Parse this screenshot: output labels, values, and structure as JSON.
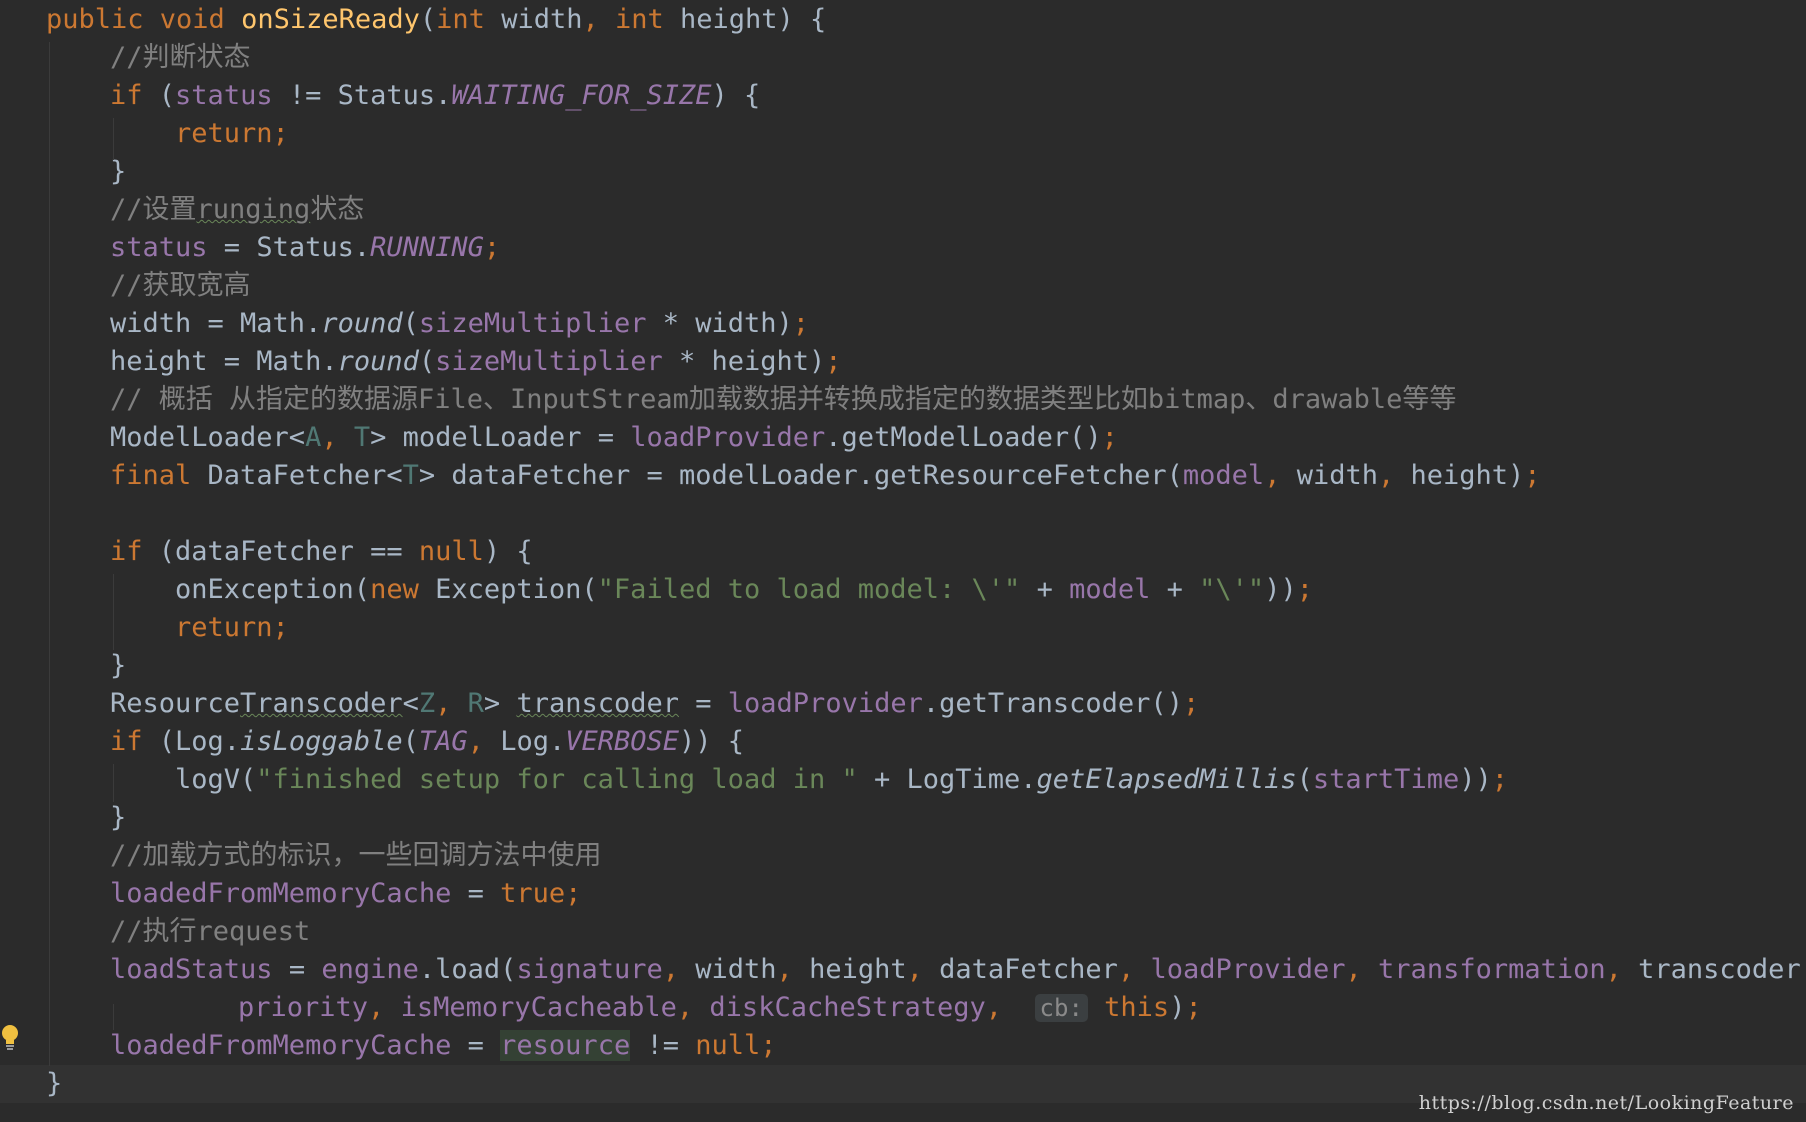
{
  "watermark": "https://blog.csdn.net/LookingFeature",
  "colors": {
    "background": "#2b2b2b",
    "keyword": "#cc7832",
    "method_decl": "#ffc66d",
    "field": "#9876aa",
    "comment": "#808080",
    "string": "#6a8759",
    "plain": "#a9b7c6",
    "type_param": "#507874"
  },
  "icons": {
    "gutter": "lightbulb-icon"
  },
  "current_line": 28,
  "lines": [
    [
      [
        "kw",
        "public void "
      ],
      [
        "fn",
        "onSizeReady"
      ],
      [
        "p",
        "("
      ],
      [
        "kw",
        "int "
      ],
      [
        "p",
        "width"
      ],
      [
        "kw",
        ", "
      ],
      [
        "kw",
        "int "
      ],
      [
        "p",
        "height) {"
      ]
    ],
    [
      [
        "cmt",
        "//判断状态"
      ]
    ],
    [
      [
        "kw",
        "if "
      ],
      [
        "p",
        "("
      ],
      [
        "f",
        "status"
      ],
      [
        "p",
        " != Status."
      ],
      [
        "fi",
        "WAITING_FOR_SIZE"
      ],
      [
        "p",
        ") {"
      ]
    ],
    [
      [
        "kw",
        "return;"
      ]
    ],
    [
      [
        "p",
        "}"
      ]
    ],
    [
      [
        "cmt",
        "//设置"
      ],
      [
        "cmt-typo",
        "runging"
      ],
      [
        "cmt",
        "状态"
      ]
    ],
    [
      [
        "f",
        "status"
      ],
      [
        "p",
        " = Status."
      ],
      [
        "fi",
        "RUNNING"
      ],
      [
        "kw",
        ";"
      ]
    ],
    [
      [
        "cmt",
        "//获取宽高"
      ]
    ],
    [
      [
        "p",
        "width = Math."
      ],
      [
        "si",
        "round"
      ],
      [
        "p",
        "("
      ],
      [
        "f",
        "sizeMultiplier"
      ],
      [
        "p",
        " * width)"
      ],
      [
        "kw",
        ";"
      ]
    ],
    [
      [
        "p",
        "height = Math."
      ],
      [
        "si",
        "round"
      ],
      [
        "p",
        "("
      ],
      [
        "f",
        "sizeMultiplier"
      ],
      [
        "p",
        " * height)"
      ],
      [
        "kw",
        ";"
      ]
    ],
    [
      [
        "cmt",
        "// 概括 从指定的数据源File、InputStream加载数据并转换成指定的数据类型比如bitmap、drawable等等"
      ]
    ],
    [
      [
        "p",
        "ModelLoader<"
      ],
      [
        "tp",
        "A"
      ],
      [
        "kw",
        ", "
      ],
      [
        "tp",
        "T"
      ],
      [
        "p",
        "> modelLoader = "
      ],
      [
        "f",
        "loadProvider"
      ],
      [
        "p",
        ".getModelLoader()"
      ],
      [
        "kw",
        ";"
      ]
    ],
    [
      [
        "kw",
        "final "
      ],
      [
        "p",
        "DataFetcher<"
      ],
      [
        "tp",
        "T"
      ],
      [
        "p",
        "> dataFetcher = modelLoader.getResourceFetcher("
      ],
      [
        "f",
        "model"
      ],
      [
        "kw",
        ", "
      ],
      [
        "p",
        "width"
      ],
      [
        "kw",
        ", "
      ],
      [
        "p",
        "height)"
      ],
      [
        "kw",
        ";"
      ]
    ],
    [],
    [
      [
        "kw",
        "if "
      ],
      [
        "p",
        "(dataFetcher == "
      ],
      [
        "kw",
        "null"
      ],
      [
        "p",
        ") {"
      ]
    ],
    [
      [
        "p",
        "onException("
      ],
      [
        "kw",
        "new "
      ],
      [
        "p",
        "Exception("
      ],
      [
        "s",
        "\"Failed to load model: \\'\""
      ],
      [
        "p",
        " + "
      ],
      [
        "f",
        "model"
      ],
      [
        "p",
        " + "
      ],
      [
        "s",
        "\"\\'\""
      ],
      [
        "p",
        "))"
      ],
      [
        "kw",
        ";"
      ]
    ],
    [
      [
        "kw",
        "return;"
      ]
    ],
    [
      [
        "p",
        "}"
      ]
    ],
    [
      [
        "p",
        "Resource"
      ],
      [
        "p-typo",
        "Transcoder"
      ],
      [
        "p",
        "<"
      ],
      [
        "tp",
        "Z"
      ],
      [
        "kw",
        ", "
      ],
      [
        "tp",
        "R"
      ],
      [
        "p",
        "> "
      ],
      [
        "p-typo",
        "transcoder"
      ],
      [
        "p",
        " = "
      ],
      [
        "f",
        "loadProvider"
      ],
      [
        "p",
        ".getTranscoder()"
      ],
      [
        "kw",
        ";"
      ]
    ],
    [
      [
        "kw",
        "if "
      ],
      [
        "p",
        "(Log."
      ],
      [
        "si",
        "isLoggable"
      ],
      [
        "p",
        "("
      ],
      [
        "fi",
        "TAG"
      ],
      [
        "kw",
        ", "
      ],
      [
        "p",
        "Log."
      ],
      [
        "fi",
        "VERBOSE"
      ],
      [
        "p",
        ")) {"
      ]
    ],
    [
      [
        "p",
        "logV("
      ],
      [
        "s",
        "\"finished setup for calling load in \""
      ],
      [
        "p",
        " + LogTime."
      ],
      [
        "si",
        "getElapsedMillis"
      ],
      [
        "p",
        "("
      ],
      [
        "f",
        "startTime"
      ],
      [
        "p",
        "))"
      ],
      [
        "kw",
        ";"
      ]
    ],
    [
      [
        "p",
        "}"
      ]
    ],
    [
      [
        "cmt",
        "//加载方式的标识，一些回调方法中使用"
      ]
    ],
    [
      [
        "f",
        "loadedFromMemoryCache"
      ],
      [
        "p",
        " = "
      ],
      [
        "kw",
        "true;"
      ]
    ],
    [
      [
        "cmt",
        "//执行request"
      ]
    ],
    [
      [
        "f",
        "loadStatus"
      ],
      [
        "p",
        " = "
      ],
      [
        "f",
        "engine"
      ],
      [
        "p",
        ".load("
      ],
      [
        "f",
        "signature"
      ],
      [
        "kw",
        ", "
      ],
      [
        "p",
        "width"
      ],
      [
        "kw",
        ", "
      ],
      [
        "p",
        "height"
      ],
      [
        "kw",
        ", "
      ],
      [
        "p",
        "dataFetcher"
      ],
      [
        "kw",
        ", "
      ],
      [
        "f",
        "loadProvider"
      ],
      [
        "kw",
        ", "
      ],
      [
        "f",
        "transformation"
      ],
      [
        "kw",
        ", "
      ],
      [
        "p",
        "transcoder"
      ],
      [
        "kw",
        ","
      ]
    ],
    [
      [
        "f",
        "priority"
      ],
      [
        "kw",
        ", "
      ],
      [
        "f",
        "isMemoryCacheable"
      ],
      [
        "kw",
        ", "
      ],
      [
        "f",
        "diskCacheStrategy"
      ],
      [
        "kw",
        ",  "
      ],
      [
        "hint",
        "cb:"
      ],
      [
        "kw",
        " this"
      ],
      [
        "p",
        ")"
      ],
      [
        "kw",
        ";"
      ]
    ],
    [
      [
        "f",
        "loadedFromMemoryCache"
      ],
      [
        "p",
        " = "
      ],
      [
        "fhl",
        "resource"
      ],
      [
        "p",
        " != "
      ],
      [
        "kw",
        "null;"
      ]
    ],
    [
      [
        "p",
        "}"
      ]
    ]
  ]
}
